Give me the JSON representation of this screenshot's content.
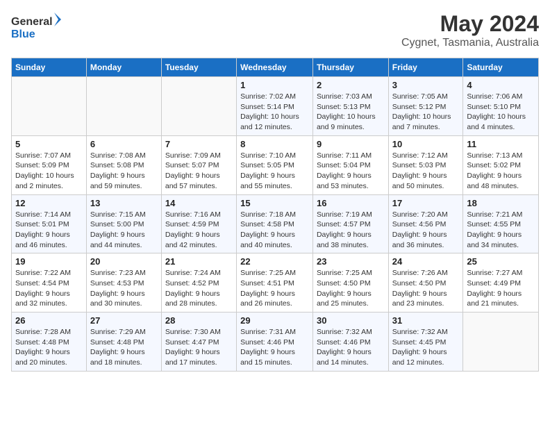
{
  "logo": {
    "line1": "General",
    "line2": "Blue"
  },
  "title": "May 2024",
  "subtitle": "Cygnet, Tasmania, Australia",
  "days_header": [
    "Sunday",
    "Monday",
    "Tuesday",
    "Wednesday",
    "Thursday",
    "Friday",
    "Saturday"
  ],
  "weeks": [
    [
      {
        "day": "",
        "info": ""
      },
      {
        "day": "",
        "info": ""
      },
      {
        "day": "",
        "info": ""
      },
      {
        "day": "1",
        "info": "Sunrise: 7:02 AM\nSunset: 5:14 PM\nDaylight: 10 hours\nand 12 minutes."
      },
      {
        "day": "2",
        "info": "Sunrise: 7:03 AM\nSunset: 5:13 PM\nDaylight: 10 hours\nand 9 minutes."
      },
      {
        "day": "3",
        "info": "Sunrise: 7:05 AM\nSunset: 5:12 PM\nDaylight: 10 hours\nand 7 minutes."
      },
      {
        "day": "4",
        "info": "Sunrise: 7:06 AM\nSunset: 5:10 PM\nDaylight: 10 hours\nand 4 minutes."
      }
    ],
    [
      {
        "day": "5",
        "info": "Sunrise: 7:07 AM\nSunset: 5:09 PM\nDaylight: 10 hours\nand 2 minutes."
      },
      {
        "day": "6",
        "info": "Sunrise: 7:08 AM\nSunset: 5:08 PM\nDaylight: 9 hours\nand 59 minutes."
      },
      {
        "day": "7",
        "info": "Sunrise: 7:09 AM\nSunset: 5:07 PM\nDaylight: 9 hours\nand 57 minutes."
      },
      {
        "day": "8",
        "info": "Sunrise: 7:10 AM\nSunset: 5:05 PM\nDaylight: 9 hours\nand 55 minutes."
      },
      {
        "day": "9",
        "info": "Sunrise: 7:11 AM\nSunset: 5:04 PM\nDaylight: 9 hours\nand 53 minutes."
      },
      {
        "day": "10",
        "info": "Sunrise: 7:12 AM\nSunset: 5:03 PM\nDaylight: 9 hours\nand 50 minutes."
      },
      {
        "day": "11",
        "info": "Sunrise: 7:13 AM\nSunset: 5:02 PM\nDaylight: 9 hours\nand 48 minutes."
      }
    ],
    [
      {
        "day": "12",
        "info": "Sunrise: 7:14 AM\nSunset: 5:01 PM\nDaylight: 9 hours\nand 46 minutes."
      },
      {
        "day": "13",
        "info": "Sunrise: 7:15 AM\nSunset: 5:00 PM\nDaylight: 9 hours\nand 44 minutes."
      },
      {
        "day": "14",
        "info": "Sunrise: 7:16 AM\nSunset: 4:59 PM\nDaylight: 9 hours\nand 42 minutes."
      },
      {
        "day": "15",
        "info": "Sunrise: 7:18 AM\nSunset: 4:58 PM\nDaylight: 9 hours\nand 40 minutes."
      },
      {
        "day": "16",
        "info": "Sunrise: 7:19 AM\nSunset: 4:57 PM\nDaylight: 9 hours\nand 38 minutes."
      },
      {
        "day": "17",
        "info": "Sunrise: 7:20 AM\nSunset: 4:56 PM\nDaylight: 9 hours\nand 36 minutes."
      },
      {
        "day": "18",
        "info": "Sunrise: 7:21 AM\nSunset: 4:55 PM\nDaylight: 9 hours\nand 34 minutes."
      }
    ],
    [
      {
        "day": "19",
        "info": "Sunrise: 7:22 AM\nSunset: 4:54 PM\nDaylight: 9 hours\nand 32 minutes."
      },
      {
        "day": "20",
        "info": "Sunrise: 7:23 AM\nSunset: 4:53 PM\nDaylight: 9 hours\nand 30 minutes."
      },
      {
        "day": "21",
        "info": "Sunrise: 7:24 AM\nSunset: 4:52 PM\nDaylight: 9 hours\nand 28 minutes."
      },
      {
        "day": "22",
        "info": "Sunrise: 7:25 AM\nSunset: 4:51 PM\nDaylight: 9 hours\nand 26 minutes."
      },
      {
        "day": "23",
        "info": "Sunrise: 7:25 AM\nSunset: 4:50 PM\nDaylight: 9 hours\nand 25 minutes."
      },
      {
        "day": "24",
        "info": "Sunrise: 7:26 AM\nSunset: 4:50 PM\nDaylight: 9 hours\nand 23 minutes."
      },
      {
        "day": "25",
        "info": "Sunrise: 7:27 AM\nSunset: 4:49 PM\nDaylight: 9 hours\nand 21 minutes."
      }
    ],
    [
      {
        "day": "26",
        "info": "Sunrise: 7:28 AM\nSunset: 4:48 PM\nDaylight: 9 hours\nand 20 minutes."
      },
      {
        "day": "27",
        "info": "Sunrise: 7:29 AM\nSunset: 4:48 PM\nDaylight: 9 hours\nand 18 minutes."
      },
      {
        "day": "28",
        "info": "Sunrise: 7:30 AM\nSunset: 4:47 PM\nDaylight: 9 hours\nand 17 minutes."
      },
      {
        "day": "29",
        "info": "Sunrise: 7:31 AM\nSunset: 4:46 PM\nDaylight: 9 hours\nand 15 minutes."
      },
      {
        "day": "30",
        "info": "Sunrise: 7:32 AM\nSunset: 4:46 PM\nDaylight: 9 hours\nand 14 minutes."
      },
      {
        "day": "31",
        "info": "Sunrise: 7:32 AM\nSunset: 4:45 PM\nDaylight: 9 hours\nand 12 minutes."
      },
      {
        "day": "",
        "info": ""
      }
    ]
  ]
}
